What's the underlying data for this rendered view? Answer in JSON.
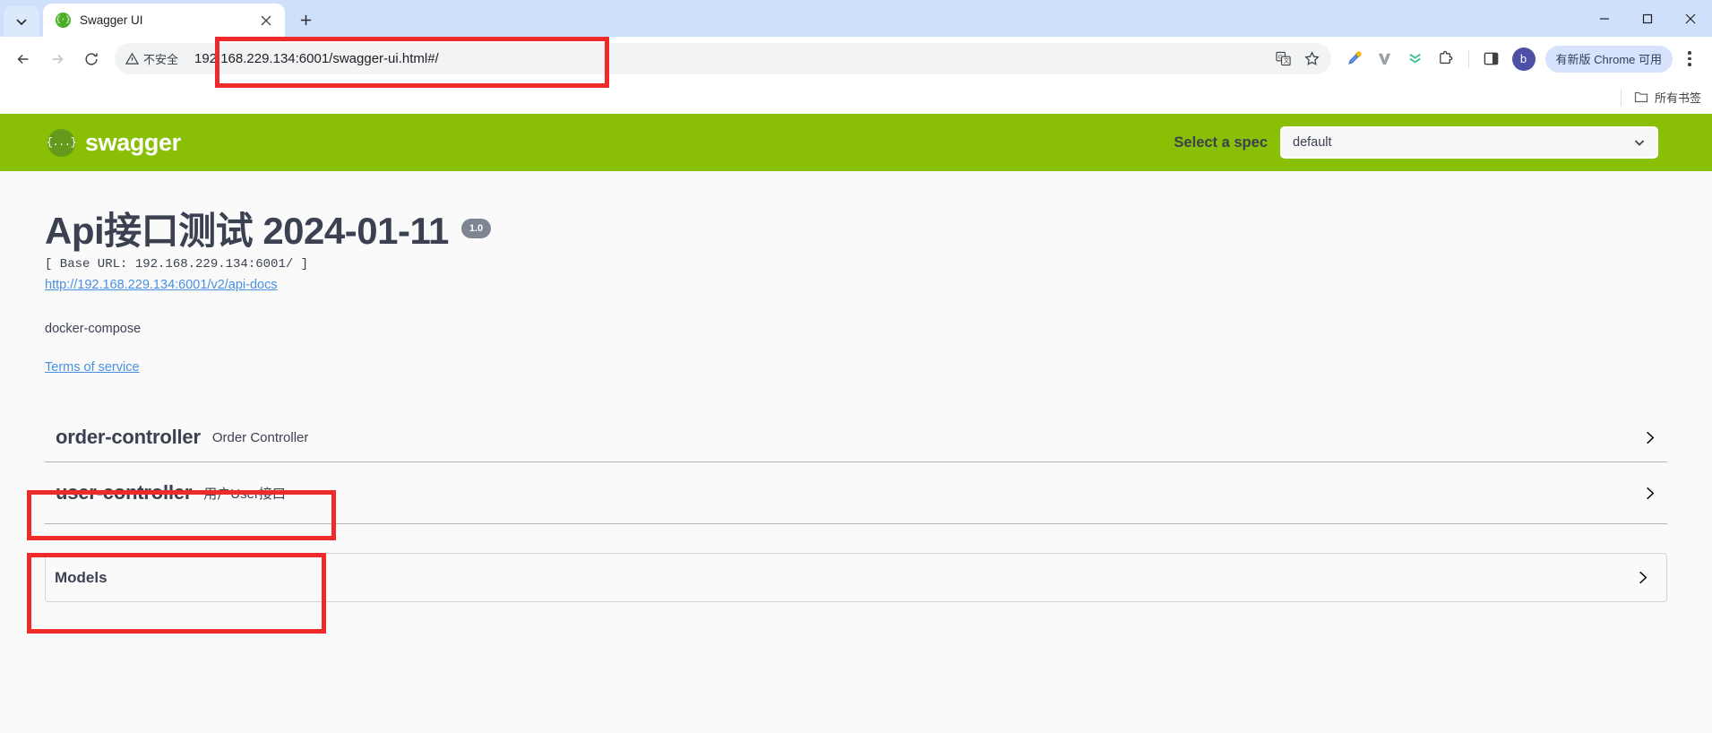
{
  "browser": {
    "tab": {
      "title": "Swagger UI",
      "favicon": "swagger-favicon",
      "close_label": "×"
    },
    "new_tab_label": "+",
    "window": {
      "minimize": "—",
      "maximize": "▢",
      "close": "✕"
    },
    "nav": {
      "back": "back-arrow",
      "forward": "forward-arrow",
      "reload": "reload-icon"
    },
    "security_label": "不安全",
    "url": "192.168.229.134:6001/swagger-ui.html#/",
    "omnibox_icons": [
      "translate-icon",
      "bookmark-star-icon"
    ],
    "extensions": [
      "eyedropper-icon",
      "vimium-icon",
      "chevrons-down-icon",
      "extensions-puzzle-icon",
      "side-panel-icon"
    ],
    "profile_initial": "b",
    "update_pill": "有新版 Chrome 可用",
    "menu": "kebab-menu-icon",
    "bookmarks": {
      "all_bookmarks": "所有书签",
      "folder_icon": "folder-icon"
    }
  },
  "swagger": {
    "topbar": {
      "logo_text": "swagger",
      "logo_mark": "{...}",
      "select_spec_label": "Select a spec",
      "selected_spec": "default",
      "caret": "chevron-down-icon"
    },
    "info": {
      "title": "Api接口测试 2024-01-11",
      "version": "1.0",
      "base_url": "[ Base URL: 192.168.229.134:6001/ ]",
      "api_docs_link": "http://192.168.229.134:6001/v2/api-docs",
      "description": "docker-compose",
      "terms_of_service": "Terms of service"
    },
    "tags": [
      {
        "name": "order-controller",
        "description": "Order Controller",
        "arrow": "chevron-right-icon"
      },
      {
        "name": "user-controller",
        "description": "用户User接口",
        "arrow": "chevron-right-icon"
      }
    ],
    "models": {
      "title": "Models",
      "arrow": "chevron-right-icon"
    }
  },
  "annotations": {
    "url_box": "highlight-url-bar",
    "order_box": "highlight-order-controller",
    "user_box": "highlight-user-controller",
    "color": "#ef2a2a"
  },
  "colors": {
    "swagger_green": "#89bf04",
    "link_blue": "#4990e2",
    "text_dark": "#3b4151",
    "chrome_tabstrip": "#cfe0fb",
    "page_bg": "#fafafa"
  }
}
